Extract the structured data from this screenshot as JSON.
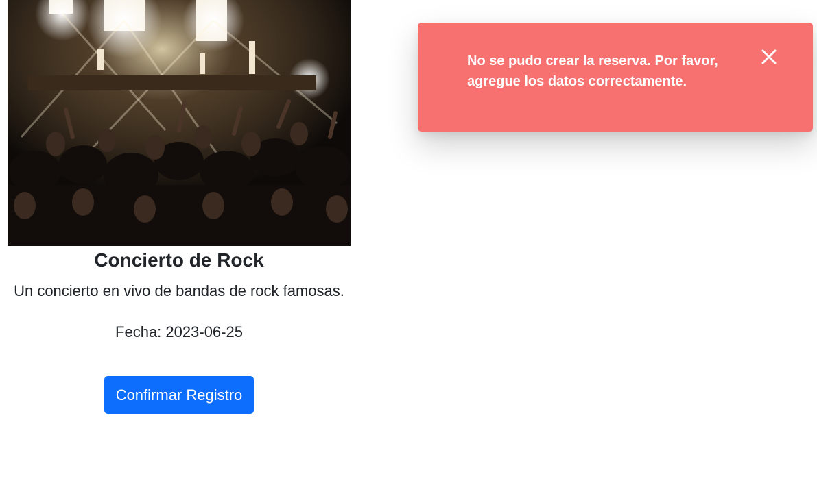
{
  "event": {
    "image_alt": "Rock concert crowd in front of a lit stage",
    "title": "Concierto de Rock",
    "description": "Un concierto en vivo de bandas de rock famosas.",
    "date_label": "Fecha:",
    "date_value": "2023-06-25",
    "confirm_button_label": "Confirmar Registro"
  },
  "toast": {
    "message": "No se pudo crear la reserva. Por favor, agregue los datos correctamente.",
    "close_icon": "close-icon"
  },
  "colors": {
    "primary_button": "#0d6efd",
    "toast_background": "#f87171",
    "text": "#212529"
  }
}
